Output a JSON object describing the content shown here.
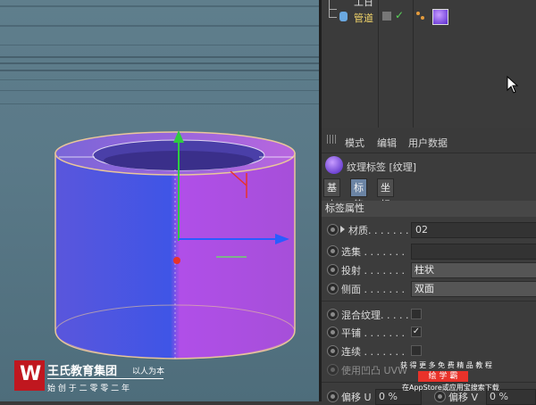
{
  "object_manager": {
    "top_item_label": "工日",
    "item_label": "管道",
    "item_checkmark": "✓"
  },
  "attributes": {
    "menu": [
      "模式",
      "编辑",
      "用户数据"
    ],
    "tag_title": "纹理标签 [纹理]",
    "tabs": [
      "基本",
      "标签",
      "坐标"
    ],
    "active_tab": "标签",
    "section_title": "标签属性",
    "properties": [
      {
        "label": "材质. . . . . . .",
        "value": "02",
        "kind": "field"
      },
      {
        "label": "选集 . . . . . . .",
        "value": "",
        "kind": "field"
      },
      {
        "label": "投射 . . . . . . .",
        "value": "柱状",
        "kind": "dropdown"
      },
      {
        "label": "侧面 . . . . . . .",
        "value": "双面",
        "kind": "dropdown"
      },
      {
        "label": "混合纹理. . . . .",
        "value": "",
        "kind": "checkbox"
      },
      {
        "label": "平铺 . . . . . . .",
        "value": "✓",
        "kind": "checkbox"
      },
      {
        "label": "连续 . . . . . . .",
        "value": "",
        "kind": "checkbox"
      },
      {
        "label": "使用凹凸 UVW",
        "value": "",
        "kind": "disabled"
      }
    ],
    "offset_u_label": "偏移 U",
    "offset_u_value": "0 %",
    "offset_v_label": "偏移 V",
    "offset_v_value": "0 %"
  },
  "watermark": {
    "logo_char": "W",
    "company": "王氏教育集团",
    "slogan": "以人为本",
    "founded": "始 创 于 二 零 零 二 年"
  },
  "ad_banner": {
    "line1": "获 得 更 多 免 费 精 品 教 程",
    "brand": "绘 学 霸",
    "line3": "在AppStore或应用宝搜索下载"
  },
  "colors": {
    "viewport_bg": "#5a7988",
    "cylinder_left": "#4f57e0",
    "cylinder_right": "#b453e6",
    "active_tab": "#6b84a4",
    "logo_red": "#c0171f",
    "axis_y": "#2ecc40",
    "axis_x": "#2a5cff",
    "axis_z": "#e8332a"
  }
}
